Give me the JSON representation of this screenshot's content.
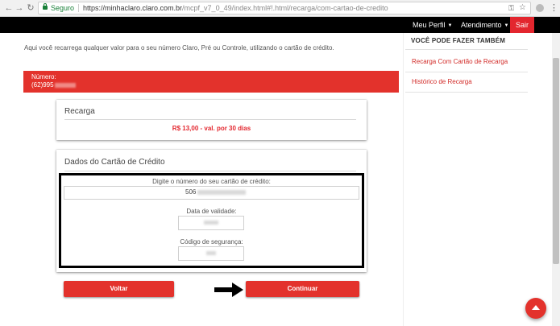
{
  "browser": {
    "secure_label": "Seguro",
    "url_host": "https://minhaclaro.claro.com.br",
    "url_path": "/mcpf_v7_0_49/index.html#!.html/recarga/com-cartao-de-credito",
    "icons": [
      "back-icon",
      "forward-icon",
      "reload-icon",
      "lock-icon",
      "key-icon",
      "star-icon",
      "extension-icon",
      "menu-icon"
    ]
  },
  "header": {
    "meu_perfil": "Meu Perfil",
    "atendimento": "Atendimento",
    "sair": "Sair"
  },
  "main": {
    "intro": "Aqui você recarrega qualquer valor para o seu número Claro, Pré ou Controle, utilizando o cartão de crédito.",
    "number_label": "Número:",
    "number_value": "(62)995",
    "recarga": {
      "title": "Recarga",
      "price": "R$ 13,00 - val. por 30 dias"
    },
    "cartao": {
      "title": "Dados do Cartão de Crédito",
      "card_number_label": "Digite o número do seu cartão de crédito:",
      "card_number_value": "506",
      "validade_label": "Data de validade:",
      "seguranca_label": "Código de segurança:"
    },
    "buttons": {
      "voltar": "Voltar",
      "continuar": "Continuar"
    }
  },
  "sidebar": {
    "title": "VOCÊ PODE FAZER TAMBÉM",
    "links": [
      "Recarga Com Cartão de Recarga",
      "Histórico de Recarga"
    ]
  },
  "colors": {
    "accent": "#e3322c",
    "topbar": "#000000",
    "secure": "#188038"
  }
}
